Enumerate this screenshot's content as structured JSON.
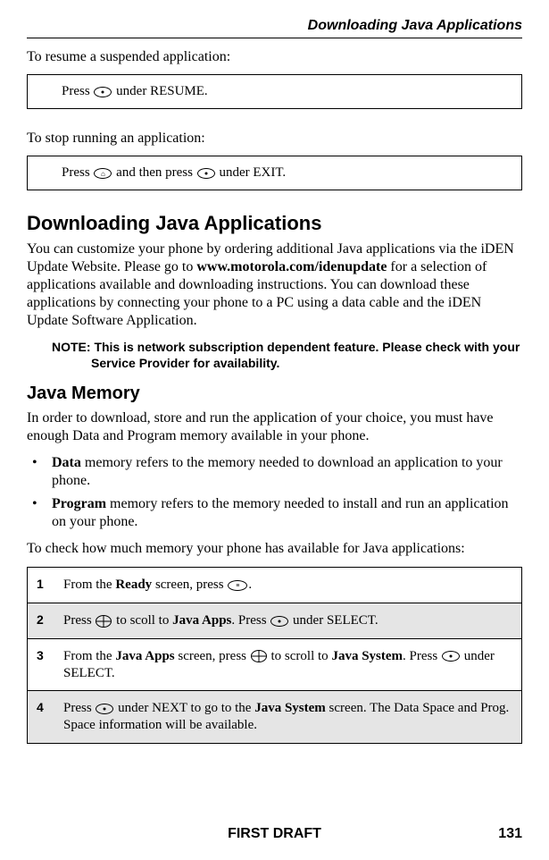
{
  "header": {
    "section_title": "Downloading Java Applications"
  },
  "resume": {
    "intro": "To resume a suspended application:",
    "instruction_prefix": "Press ",
    "instruction_suffix": " under RESUME."
  },
  "stop": {
    "intro": "To stop running an application:",
    "instruction_prefix": "Press ",
    "instruction_mid": " and then press ",
    "instruction_suffix": " under EXIT."
  },
  "downloading": {
    "heading": "Downloading Java Applications",
    "body_part1": "You can customize your phone by ordering additional Java applications via the iDEN Update Website. Please go to ",
    "body_bold1": "www.motorola.com/idenupdate",
    "body_part2": " for a selection of applications available and downloading instructions. You can download these applications by connecting your phone to a PC using a data cable and the iDEN Update Software Application.",
    "note": "NOTE: This is network subscription dependent feature. Please check with your Service Provider for availability."
  },
  "memory": {
    "heading": "Java Memory",
    "intro": "In order to download, store and run the application of your choice, you must have enough Data and Program memory available in your phone.",
    "bullets": [
      {
        "bold": "Data",
        "rest": " memory refers to the memory needed to download an application to your phone."
      },
      {
        "bold": "Program",
        "rest": " memory refers to the memory needed to install and run an application on your phone."
      }
    ],
    "check_intro": "To check how much memory your phone has available for Java applications:"
  },
  "steps": [
    {
      "num": "1",
      "parts": [
        "From the ",
        "Ready",
        " screen, press ",
        "ICON_MENU",
        "."
      ]
    },
    {
      "num": "2",
      "parts": [
        "Press ",
        "ICON_NAV",
        " to scoll to ",
        "Java Apps",
        ". Press ",
        "ICON_OVAL",
        " under SELECT."
      ]
    },
    {
      "num": "3",
      "parts": [
        "From the ",
        "Java Apps",
        " screen, press ",
        "ICON_NAV",
        " to scroll to ",
        "Java System",
        ". Press ",
        "ICON_OVAL",
        " under SELECT."
      ]
    },
    {
      "num": "4",
      "parts": [
        "Press ",
        "ICON_OVAL",
        " under NEXT to go to the ",
        "Java System",
        " screen. The Data Space and Prog. Space information will be available."
      ]
    }
  ],
  "footer": {
    "draft": "FIRST DRAFT",
    "page": "131"
  }
}
